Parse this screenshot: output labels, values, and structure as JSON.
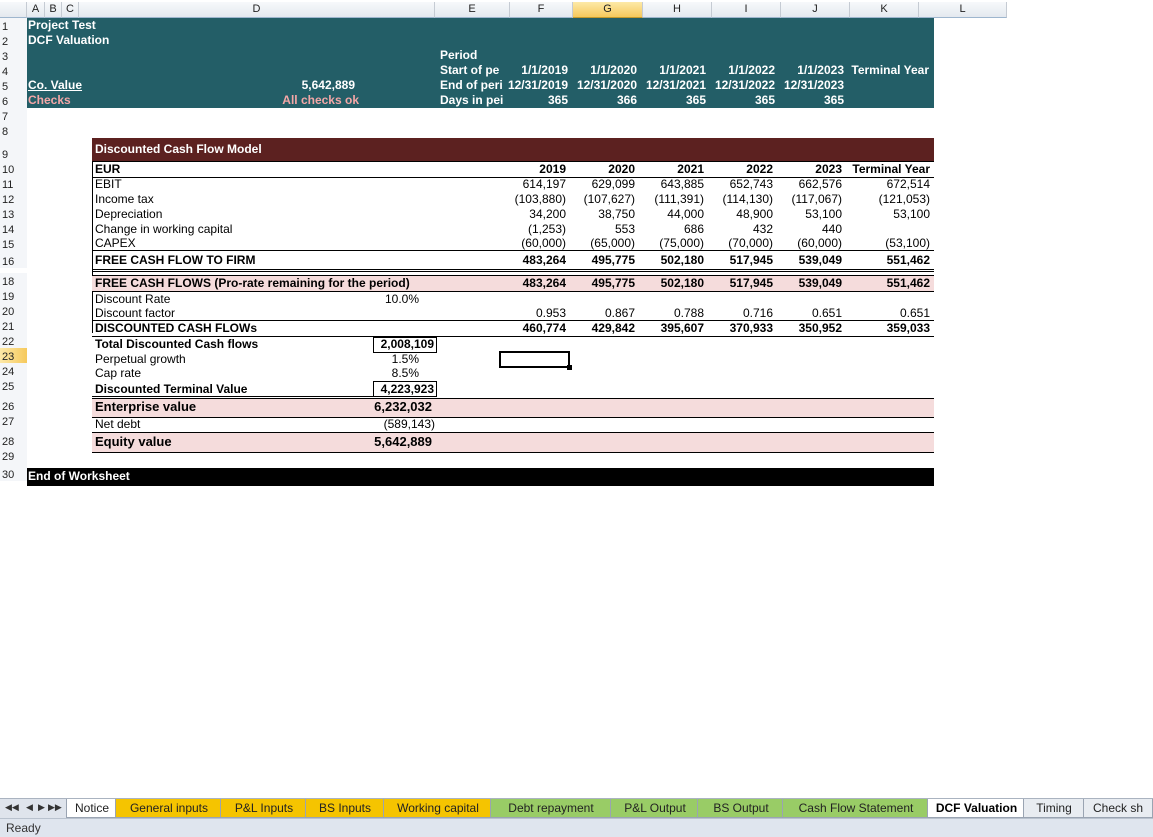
{
  "columns": [
    {
      "label": "A",
      "w": 18
    },
    {
      "label": "B",
      "w": 17
    },
    {
      "label": "C",
      "w": 17
    },
    {
      "label": "D",
      "w": 356
    },
    {
      "label": "E",
      "w": 75
    },
    {
      "label": "F",
      "w": 63
    },
    {
      "label": "G",
      "w": 70
    },
    {
      "label": "H",
      "w": 69
    },
    {
      "label": "I",
      "w": 69
    },
    {
      "label": "J",
      "w": 69
    },
    {
      "label": "K",
      "w": 69
    },
    {
      "label": "L",
      "w": 88
    }
  ],
  "selected_column": "G",
  "rows": [
    "1",
    "2",
    "3",
    "4",
    "5",
    "6",
    "7",
    "8",
    "9",
    "10",
    "11",
    "12",
    "13",
    "14",
    "15",
    "16",
    "18",
    "19",
    "20",
    "21",
    "22",
    "23",
    "24",
    "25",
    "26",
    "27",
    "28",
    "29",
    "30"
  ],
  "selected_row": "23",
  "header": {
    "title": "Project Test",
    "subtitle": "DCF Valuation",
    "period_label": "Period",
    "start_label": "Start of pe",
    "end_label": "End of peri",
    "days_label": "Days in pei",
    "co_value_label": "Co. Value",
    "co_value": "5,642,889",
    "checks_label": "Checks",
    "checks_status": "All checks ok",
    "start_dates": [
      "1/1/2019",
      "1/1/2020",
      "1/1/2021",
      "1/1/2022",
      "1/1/2023"
    ],
    "terminal_label": "Terminal Year",
    "end_dates": [
      "12/31/2019",
      "12/31/2020",
      "12/31/2021",
      "12/31/2022",
      "12/31/2023"
    ],
    "days": [
      "365",
      "366",
      "365",
      "365",
      "365"
    ]
  },
  "model": {
    "title": "Discounted Cash Flow Model",
    "currency": "EUR",
    "years": [
      "2019",
      "2020",
      "2021",
      "2022",
      "2023",
      "Terminal Year"
    ],
    "ebit": {
      "label": "EBIT",
      "values": [
        "614,197",
        "629,099",
        "643,885",
        "652,743",
        "662,576",
        "672,514"
      ]
    },
    "income_tax": {
      "label": "Income tax",
      "values": [
        "(103,880)",
        "(107,627)",
        "(111,391)",
        "(114,130)",
        "(117,067)",
        "(121,053)"
      ]
    },
    "depreciation": {
      "label": "Depreciation",
      "values": [
        "34,200",
        "38,750",
        "44,000",
        "48,900",
        "53,100",
        "53,100"
      ]
    },
    "working_capital": {
      "label": "Change in working capital",
      "values": [
        "(1,253)",
        "553",
        "686",
        "432",
        "440",
        ""
      ]
    },
    "capex": {
      "label": "CAPEX",
      "values": [
        "(60,000)",
        "(65,000)",
        "(75,000)",
        "(70,000)",
        "(60,000)",
        "(53,100)"
      ]
    },
    "fcff": {
      "label": "FREE CASH FLOW TO FIRM",
      "values": [
        "483,264",
        "495,775",
        "502,180",
        "517,945",
        "539,049",
        "551,462"
      ]
    },
    "fcf_prorate": {
      "label": "FREE CASH FLOWS (Pro-rate remaining for the period)",
      "values": [
        "483,264",
        "495,775",
        "502,180",
        "517,945",
        "539,049",
        "551,462"
      ]
    },
    "discount_rate": {
      "label": "Discount Rate",
      "value": "10.0%"
    },
    "discount_factor": {
      "label": "Discount factor",
      "values": [
        "0.953",
        "0.867",
        "0.788",
        "0.716",
        "0.651",
        "0.651"
      ]
    },
    "dcf": {
      "label": "DISCOUNTED CASH FLOWs",
      "values": [
        "460,774",
        "429,842",
        "395,607",
        "370,933",
        "350,952",
        "359,033"
      ]
    },
    "total_dcf": {
      "label": "Total Discounted Cash flows",
      "value": "2,008,109"
    },
    "perpetual_growth": {
      "label": "Perpetual growth",
      "value": "1.5%"
    },
    "cap_rate": {
      "label": "Cap rate",
      "value": "8.5%"
    },
    "terminal_value": {
      "label": "Discounted Terminal Value",
      "value": "4,223,923"
    },
    "enterprise_value": {
      "label": "Enterprise value",
      "value": "6,232,032"
    },
    "net_debt": {
      "label": "Net debt",
      "value": "(589,143)"
    },
    "equity_value": {
      "label": "Equity value",
      "value": "5,642,889"
    }
  },
  "end_label": "End of Worksheet",
  "tabs": [
    {
      "label": "Notice",
      "color": "#ffffff"
    },
    {
      "label": "General inputs",
      "color": "#f5c400"
    },
    {
      "label": "P&L Inputs",
      "color": "#f5c400"
    },
    {
      "label": "BS Inputs",
      "color": "#f5c400"
    },
    {
      "label": "Working capital",
      "color": "#f5c400"
    },
    {
      "label": "Debt repayment",
      "color": "#99cc66"
    },
    {
      "label": "P&L Output",
      "color": "#99cc66"
    },
    {
      "label": "BS Output",
      "color": "#99cc66"
    },
    {
      "label": "Cash Flow Statement",
      "color": "#99cc66"
    },
    {
      "label": "DCF Valuation",
      "color": "#ffffff"
    },
    {
      "label": "Timing",
      "color": "#e8ecf1"
    },
    {
      "label": "Check sh",
      "color": "#e8ecf1"
    }
  ],
  "active_tab": "DCF Valuation",
  "status": "Ready"
}
